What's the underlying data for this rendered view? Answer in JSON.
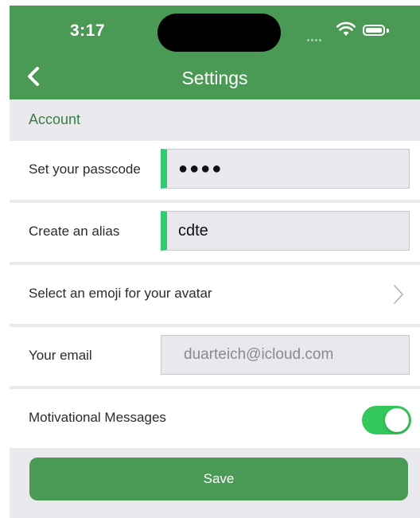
{
  "status_bar": {
    "time": "3:17"
  },
  "nav": {
    "title": "Settings",
    "back_icon": "chevron-left-icon"
  },
  "section": {
    "title": "Account"
  },
  "rows": {
    "passcode": {
      "label": "Set your passcode",
      "value": "●●●●"
    },
    "alias": {
      "label": "Create an alias",
      "value": "cdte"
    },
    "emoji": {
      "label": "Select an emoji for your avatar",
      "icon": "chevron-right-icon"
    },
    "email": {
      "label": "Your email",
      "placeholder": "duarteich@icloud.com"
    },
    "motivational": {
      "label": "Motivational Messages",
      "enabled": true
    }
  },
  "save_button": {
    "label": "Save"
  },
  "colors": {
    "header": "#4a9a55",
    "accent": "#2ecc71",
    "toggle_on": "#34c759",
    "section_text": "#3a7d44",
    "background": "#eaeaee"
  }
}
